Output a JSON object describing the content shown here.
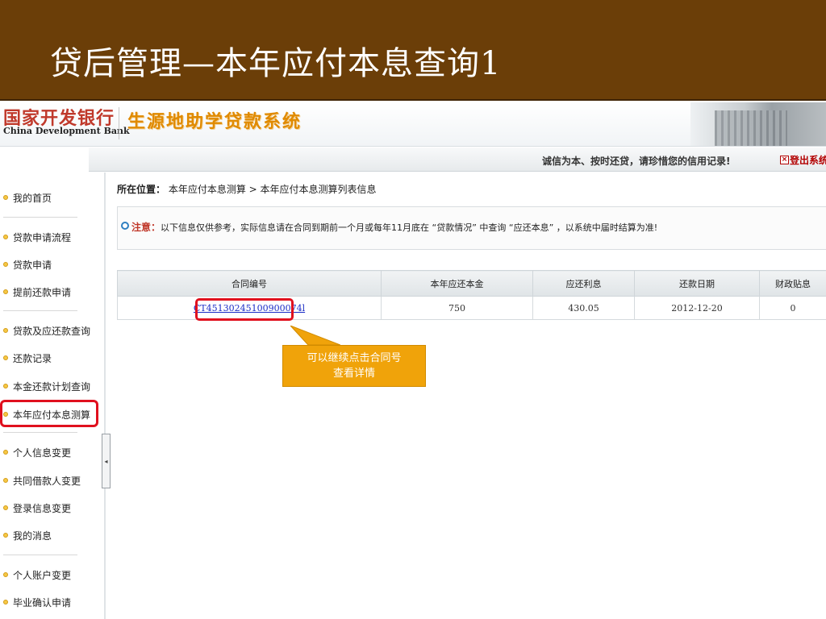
{
  "slide": {
    "title": "贷后管理—本年应付本息查询1"
  },
  "header": {
    "bank_name_cn": "国家开发银行",
    "bank_name_en": "China Development Bank",
    "system_name": "生源地助学贷款系统",
    "slogan": "诚信为本、按时还贷，请珍惜您的信用记录!",
    "logout_icon": "×",
    "logout_label": "登出系统"
  },
  "sidebar": {
    "items": [
      {
        "label": "我的首页"
      },
      {
        "label": "贷款申请流程"
      },
      {
        "label": "贷款申请"
      },
      {
        "label": "提前还款申请"
      },
      {
        "label": "贷款及应还款查询"
      },
      {
        "label": "还款记录"
      },
      {
        "label": "本金还款计划查询"
      },
      {
        "label": "本年应付本息测算"
      },
      {
        "label": "个人信息变更"
      },
      {
        "label": "共同借款人变更"
      },
      {
        "label": "登录信息变更"
      },
      {
        "label": "我的消息"
      },
      {
        "label": "个人账户变更"
      },
      {
        "label": "毕业确认申请"
      }
    ],
    "active_index": 7,
    "collapse_icon": "◂"
  },
  "main": {
    "breadcrumb_label": "所在位置：",
    "breadcrumb_path": "本年应付本息测算 > 本年应付本息测算列表信息",
    "notice_label": "注意：",
    "notice_text": "以下信息仅供参考，实际信息请在合同到期前一个月或每年11月底在 “贷款情况” 中查询 “应还本息” ，以系统中届时结算为准!",
    "table": {
      "columns": [
        "合同编号",
        "本年应还本金",
        "应还利息",
        "还款日期",
        "财政贴息"
      ],
      "rows": [
        {
          "contract_no": "CT45130245100900074l",
          "principal": "750",
          "interest": "430.05",
          "repay_date": "2012-12-20",
          "subsidy": "0"
        }
      ]
    }
  },
  "callout": {
    "text_line1": "可以继续点击合同号",
    "text_line2": "查看详情"
  },
  "colors": {
    "title_band": "#6b3e08",
    "highlight": "#e0101e",
    "callout": "#f0a30a",
    "link": "#1a2cc6"
  }
}
